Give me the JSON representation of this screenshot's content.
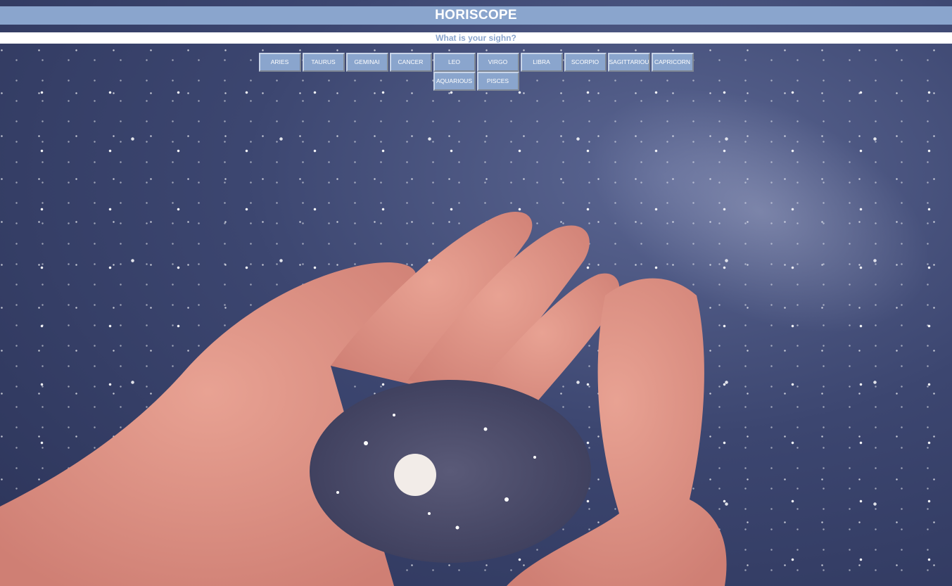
{
  "header": {
    "title": "HORISCOPE"
  },
  "prompt": {
    "text": "What is your sighn?"
  },
  "signs": {
    "row1": [
      "ARIES",
      "TAURUS",
      "GEMINAI",
      "CANCER",
      "LEO",
      "VIRGO",
      "LIBRA",
      "SCORPIO",
      "SAGITTARIOUS",
      "CAPRICORN"
    ],
    "row2": [
      "AQUARIOUS",
      "PISCES"
    ]
  },
  "colors": {
    "accent": "#8aa5cd",
    "header_text": "#ffffff",
    "background": "#3c4670"
  },
  "background_image": {
    "icon": "cupped-hands-holding-stars-illustration"
  }
}
